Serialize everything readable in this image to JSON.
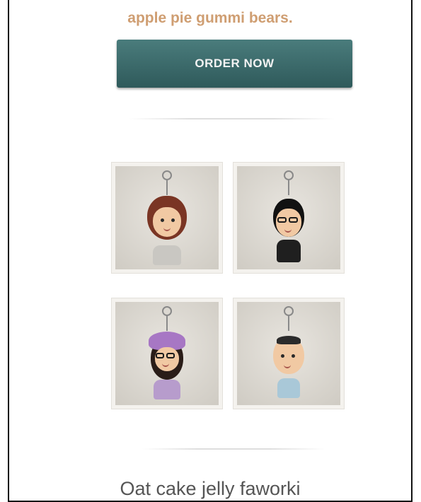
{
  "promo": {
    "tagline": "apple pie gummi bears.",
    "order_button_label": "ORDER NOW"
  },
  "gallery": {
    "items": [
      {
        "icon": "keychain-woman-brown-hair-icon"
      },
      {
        "icon": "keychain-man-glasses-icon"
      },
      {
        "icon": "keychain-woman-purple-hat-icon"
      },
      {
        "icon": "keychain-baby-icon"
      }
    ]
  },
  "section": {
    "headline": "Oat cake jelly faworki"
  },
  "colors": {
    "accent_text": "#cf9e72",
    "button_bg": "#356466",
    "button_text": "#f2f2f2"
  }
}
